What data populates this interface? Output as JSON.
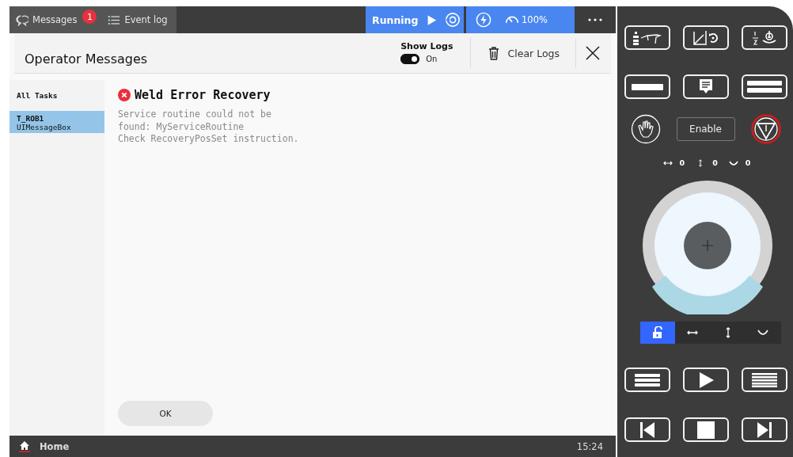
{
  "top_bar": {
    "tabs": [
      {
        "label": "Messages",
        "badge": "1"
      },
      {
        "label": "Event log"
      }
    ],
    "run_state": "Running",
    "speed": "100%"
  },
  "dialog": {
    "title": "Operator Messages",
    "show_logs": {
      "label": "Show Logs",
      "on": true,
      "state_text": "On"
    },
    "clear_logs": "Clear Logs"
  },
  "tasks": [
    {
      "title": "All Tasks",
      "selected": false
    },
    {
      "title": "T_ROB1",
      "subtitle": "UIMessageBox",
      "selected": true
    }
  ],
  "message": {
    "title": "Weld Error Recovery",
    "lines": [
      "Service routine could not be",
      "found: MyServiceRoutine",
      "Check RecoveryPosSet instruction."
    ]
  },
  "ok_button": "OK",
  "bottom_bar": {
    "home": "Home",
    "time": "15:24"
  },
  "control_panel": {
    "enable": "Enable",
    "readings": [
      {
        "kind": "horizontal",
        "value": "0"
      },
      {
        "kind": "vertical",
        "value": "0"
      },
      {
        "kind": "rotate",
        "value": "0"
      }
    ],
    "jog_modes": [
      {
        "kind": "lock",
        "selected": true
      },
      {
        "kind": "horizontal",
        "selected": false
      },
      {
        "kind": "vertical",
        "selected": false
      },
      {
        "kind": "rotate",
        "selected": false
      }
    ]
  }
}
